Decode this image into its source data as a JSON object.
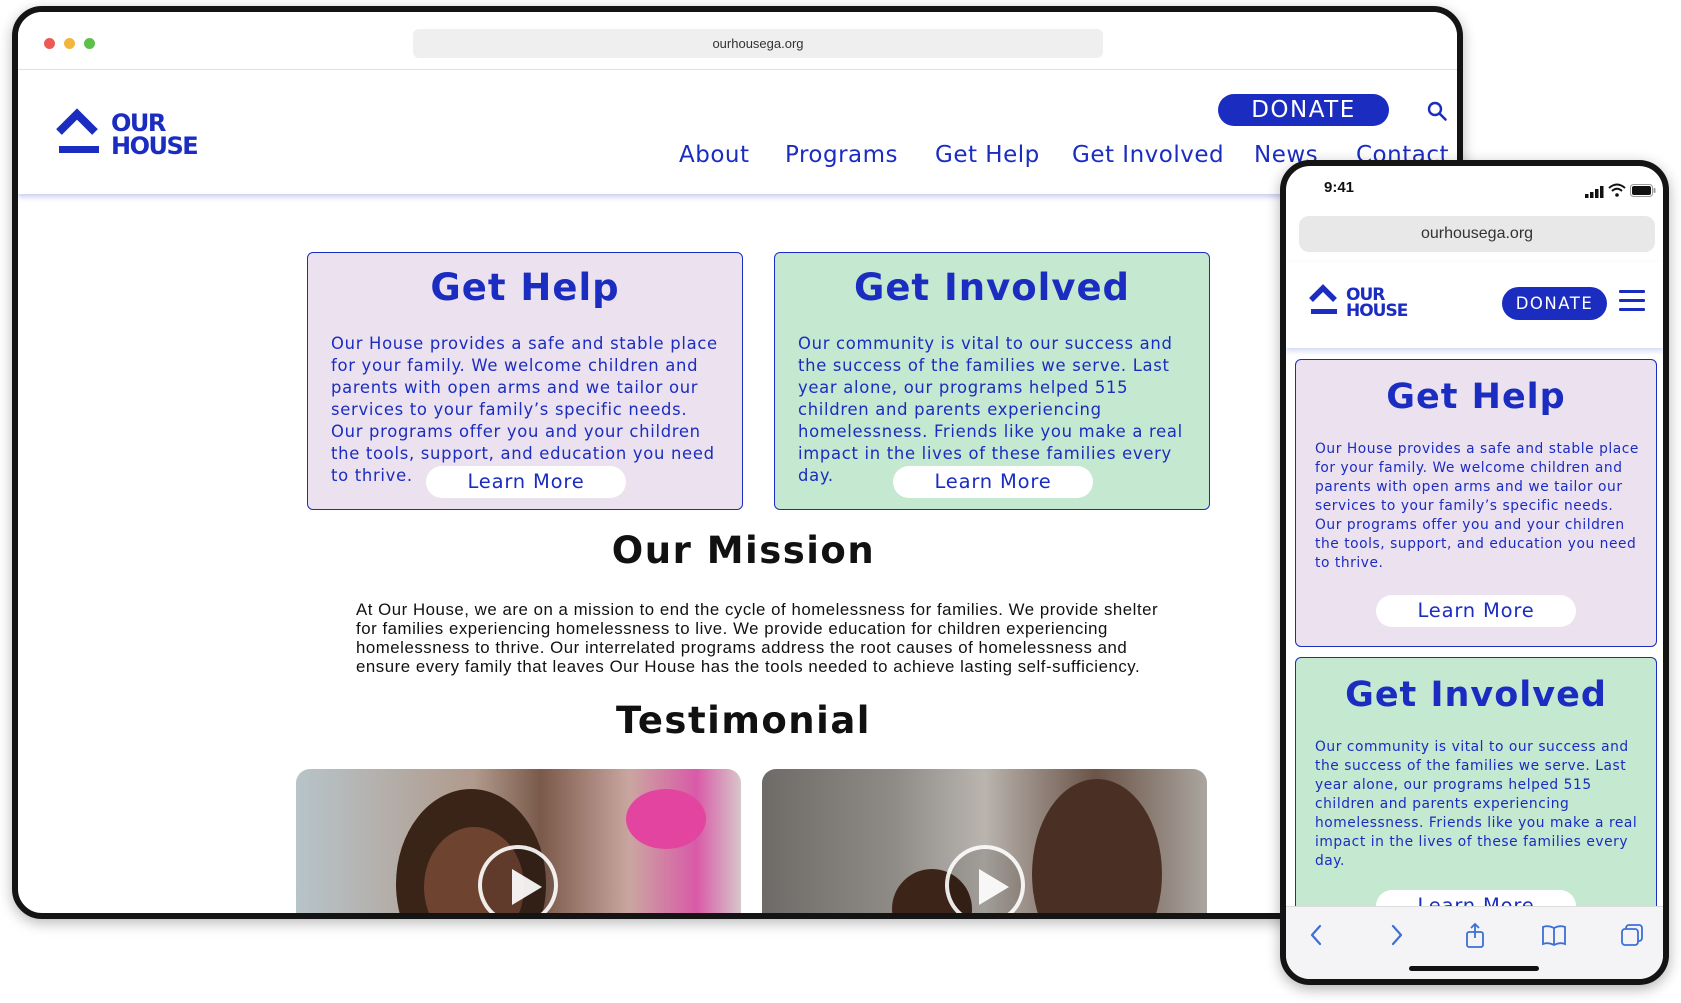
{
  "desktop": {
    "url": "ourhousega.org",
    "logo": {
      "line1": "OUR",
      "line2": "HOUSE"
    },
    "donate_label": "DONATE",
    "nav": [
      "About",
      "Programs",
      "Get Help",
      "Get Involved",
      "News",
      "Contact"
    ],
    "cards": [
      {
        "title": "Get Help",
        "body": "Our House provides a safe and stable place for your family. We welcome children and parents with open arms and we tailor our services to your family’s specific needs. Our programs offer you and your children the tools, support, and education you need to thrive.",
        "button": "Learn More"
      },
      {
        "title": "Get Involved",
        "body": "Our community is vital to our success and the success of the families we serve. Last year alone, our programs helped 515 children and parents experiencing homelessness. Friends like you make a real impact in the lives of these families every day.",
        "button": "Learn More"
      }
    ],
    "mission": {
      "title": "Our Mission",
      "text": "At Our House, we are on a mission to end the cycle of homelessness for families. We provide shelter for families experiencing homelessness to live. We provide education for children experiencing homelessness to thrive. Our interrelated programs address the root causes of homelessness and ensure every family that leaves Our House has the tools needed to achieve lasting self-sufficiency."
    },
    "testimonial_title": "Testimonial"
  },
  "mobile": {
    "status_time": "9:41",
    "url": "ourhousega.org",
    "logo": {
      "line1": "OUR",
      "line2": "HOUSE"
    },
    "donate_label": "DONATE",
    "cards": [
      {
        "title": "Get Help",
        "body": "Our House provides a safe and stable place for your family. We welcome children and parents with open arms and we tailor our services to your family’s specific needs. Our programs offer you and your children the tools, support, and education you need to thrive.",
        "button": "Learn More"
      },
      {
        "title": "Get Involved",
        "body": "Our community is vital to our success and the success of the families we serve. Last year alone, our programs helped 515 children and parents experiencing homelessness. Friends like you make a real impact in the lives of these families every day.",
        "button": "Learn More"
      }
    ],
    "toolbar_icons": [
      "back-icon",
      "forward-icon",
      "share-icon",
      "bookmarks-icon",
      "tabs-icon"
    ]
  },
  "colors": {
    "brand_blue": "#1b2cc1",
    "help_card_bg": "#ece1ee",
    "involved_card_bg": "#c4e8d0"
  }
}
